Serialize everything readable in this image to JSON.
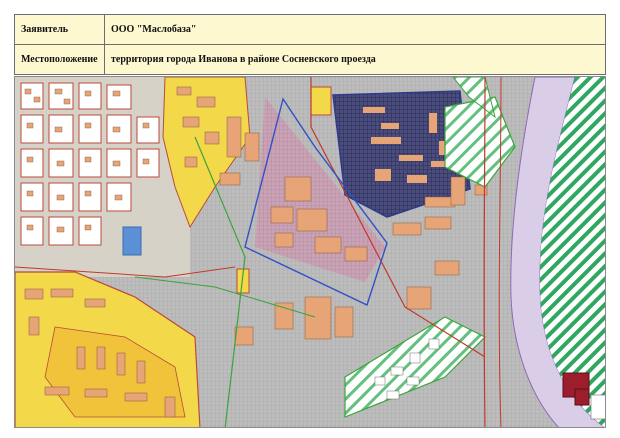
{
  "info": {
    "applicant_label": "Заявитель",
    "applicant_value": "ООО \"Маслобаза\"",
    "location_label": "Местоположение",
    "location_value": "территория города Иванова в районе Сосневского проезда"
  },
  "map": {
    "colors": {
      "industrial": "#b7b7b7",
      "buildings": "#e6a477",
      "residential": "#f3d94a",
      "residential_dark": "#f0c33a",
      "green_hatch": "#2fa760",
      "water": "#d9cde8",
      "navy_zone": "#3c3f6e",
      "boundary_red": "#c0392b",
      "boundary_blue": "#3050c8",
      "boundary_green": "#3ba43b",
      "highlight": "#9c1d2b"
    }
  }
}
